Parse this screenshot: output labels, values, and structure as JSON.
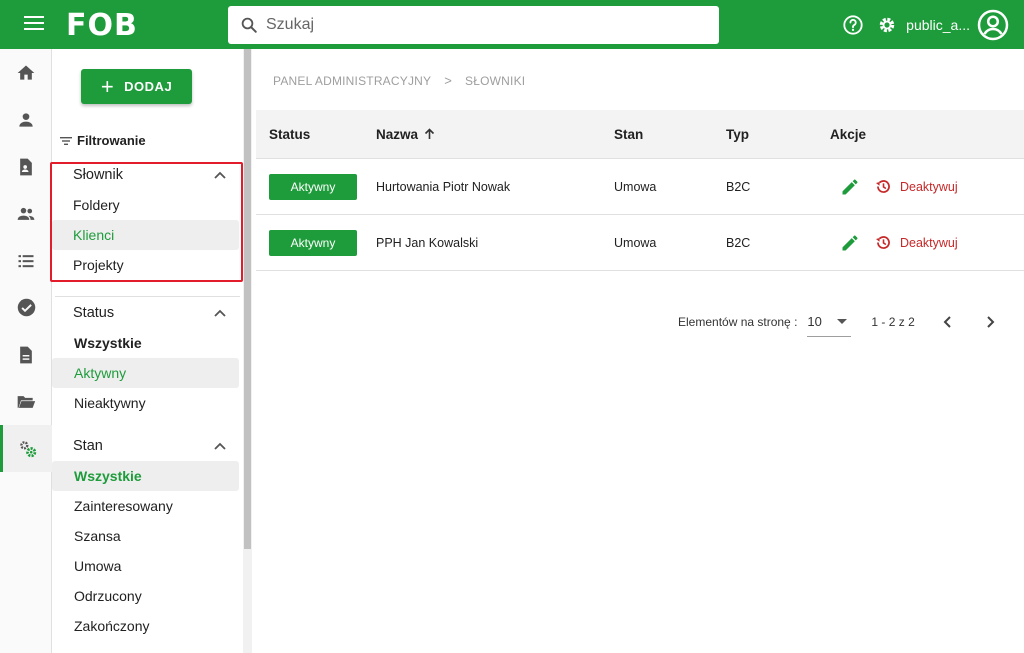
{
  "app": {
    "logo": "FOB",
    "brand_color": "#1e9c3b"
  },
  "header": {
    "search_placeholder": "Szukaj",
    "username": "public_a..."
  },
  "leftnav": {
    "icons": [
      "home-icon",
      "person-icon",
      "document-account-icon",
      "group-icon",
      "list-icon",
      "check-circle-icon",
      "description-icon",
      "folder-open-icon",
      "settings-gears-icon"
    ],
    "active_index": 8
  },
  "filters": {
    "add_label": "DODAJ",
    "title": "Filtrowanie",
    "groups": [
      {
        "label": "Słownik",
        "options": [
          "Foldery",
          "Klienci",
          "Projekty"
        ]
      },
      {
        "label": "Status",
        "options": [
          "Wszystkie",
          "Aktywny",
          "Nieaktywny"
        ]
      },
      {
        "label": "Stan",
        "options": [
          "Wszystkie",
          "Zainteresowany",
          "Szansa",
          "Umowa",
          "Odrzucony",
          "Zakończony"
        ]
      }
    ]
  },
  "breadcrumb": {
    "root": "PANEL ADMINISTRACYJNY",
    "sep": ">",
    "current": "SŁOWNIKI"
  },
  "table": {
    "headers": [
      "Status",
      "Nazwa",
      "Stan",
      "Typ",
      "Akcje"
    ],
    "rows": [
      {
        "status": "Aktywny",
        "name": "Hurtowania Piotr Nowak",
        "stan": "Umowa",
        "typ": "B2C",
        "action": "Deaktywuj"
      },
      {
        "status": "Aktywny",
        "name": "PPH Jan Kowalski",
        "stan": "Umowa",
        "typ": "B2C",
        "action": "Deaktywuj"
      }
    ]
  },
  "pager": {
    "label": "Elementów na stronę :",
    "page_size": "10",
    "range": "1 - 2 z 2"
  }
}
